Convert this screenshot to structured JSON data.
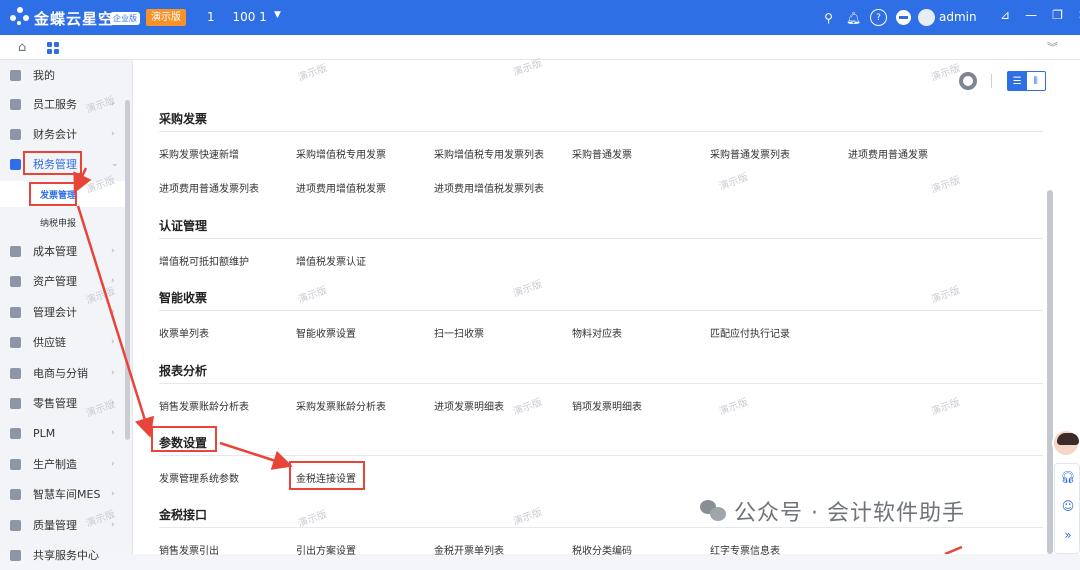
{
  "topbar": {
    "brand": "金蝶云星空",
    "edition": "企业版",
    "demo_badge": "演示版",
    "org_id": "1",
    "org_name": "100 1",
    "username": "admin",
    "bg_color": "#2f6fe6",
    "icons": [
      "search-icon",
      "bell-icon",
      "help-icon",
      "minus-circle-icon"
    ],
    "window_controls": [
      "pin-icon",
      "minimize-icon",
      "restore-icon",
      "close-icon"
    ]
  },
  "subbar": {
    "icons": [
      "home-icon",
      "apps-grid-icon",
      "double-chevron-down-icon"
    ]
  },
  "sidebar": {
    "items": [
      {
        "label": "我的",
        "icon": "my-icon"
      },
      {
        "label": "员工服务",
        "icon": "staff-icon"
      },
      {
        "label": "财务会计",
        "icon": "finance-icon"
      },
      {
        "label": "税务管理",
        "icon": "tax-icon"
      },
      {
        "label": "成本管理",
        "icon": "cost-icon"
      },
      {
        "label": "资产管理",
        "icon": "asset-icon"
      },
      {
        "label": "管理会计",
        "icon": "mgmt-accounting-icon"
      },
      {
        "label": "供应链",
        "icon": "supply-chain-icon"
      },
      {
        "label": "电商与分销",
        "icon": "ecommerce-icon"
      },
      {
        "label": "零售管理",
        "icon": "retail-icon"
      },
      {
        "label": "PLM",
        "icon": "plm-icon"
      },
      {
        "label": "生产制造",
        "icon": "manufacturing-icon"
      },
      {
        "label": "智慧车间MES",
        "icon": "mes-icon"
      },
      {
        "label": "质量管理",
        "icon": "quality-icon"
      },
      {
        "label": "共享服务中心",
        "icon": "shared-service-icon"
      }
    ],
    "sub_items": [
      {
        "label": "发票管理"
      },
      {
        "label": "纳税申报"
      }
    ]
  },
  "toolbar": {
    "icons": [
      "settings-icon",
      "list-view-icon",
      "column-view-icon"
    ]
  },
  "sections": [
    {
      "title": "采购发票",
      "links": [
        "采购发票快速新增",
        "采购增值税专用发票",
        "采购增值税专用发票列表",
        "采购普通发票",
        "采购普通发票列表",
        "进项费用普通发票",
        "进项费用普通发票列表",
        "进项费用增值税发票",
        "进项费用增值税发票列表"
      ]
    },
    {
      "title": "认证管理",
      "links": [
        "增值税可抵扣额维护",
        "增值税发票认证"
      ]
    },
    {
      "title": "智能收票",
      "links": [
        "收票单列表",
        "智能收票设置",
        "扫一扫收票",
        "物料对应表",
        "匹配应付执行记录"
      ]
    },
    {
      "title": "报表分析",
      "links": [
        "销售发票账龄分析表",
        "采购发票账龄分析表",
        "进项发票明细表",
        "销项发票明细表"
      ]
    },
    {
      "title": "参数设置",
      "links": [
        "发票管理系统参数",
        "金税连接设置"
      ]
    },
    {
      "title": "金税接口",
      "links": [
        "销售发票引出",
        "引出方案设置",
        "金税开票单列表",
        "税收分类编码",
        "红字专票信息表"
      ]
    }
  ],
  "watermark": "演示版",
  "overlay": {
    "wechat_text": "公众号 · 会计软件助手",
    "highlight_color": "#e8443a"
  },
  "float_panel": {
    "icons": [
      "assistant-avatar",
      "headset-icon",
      "smile-icon",
      "double-chevron-right-icon"
    ]
  }
}
